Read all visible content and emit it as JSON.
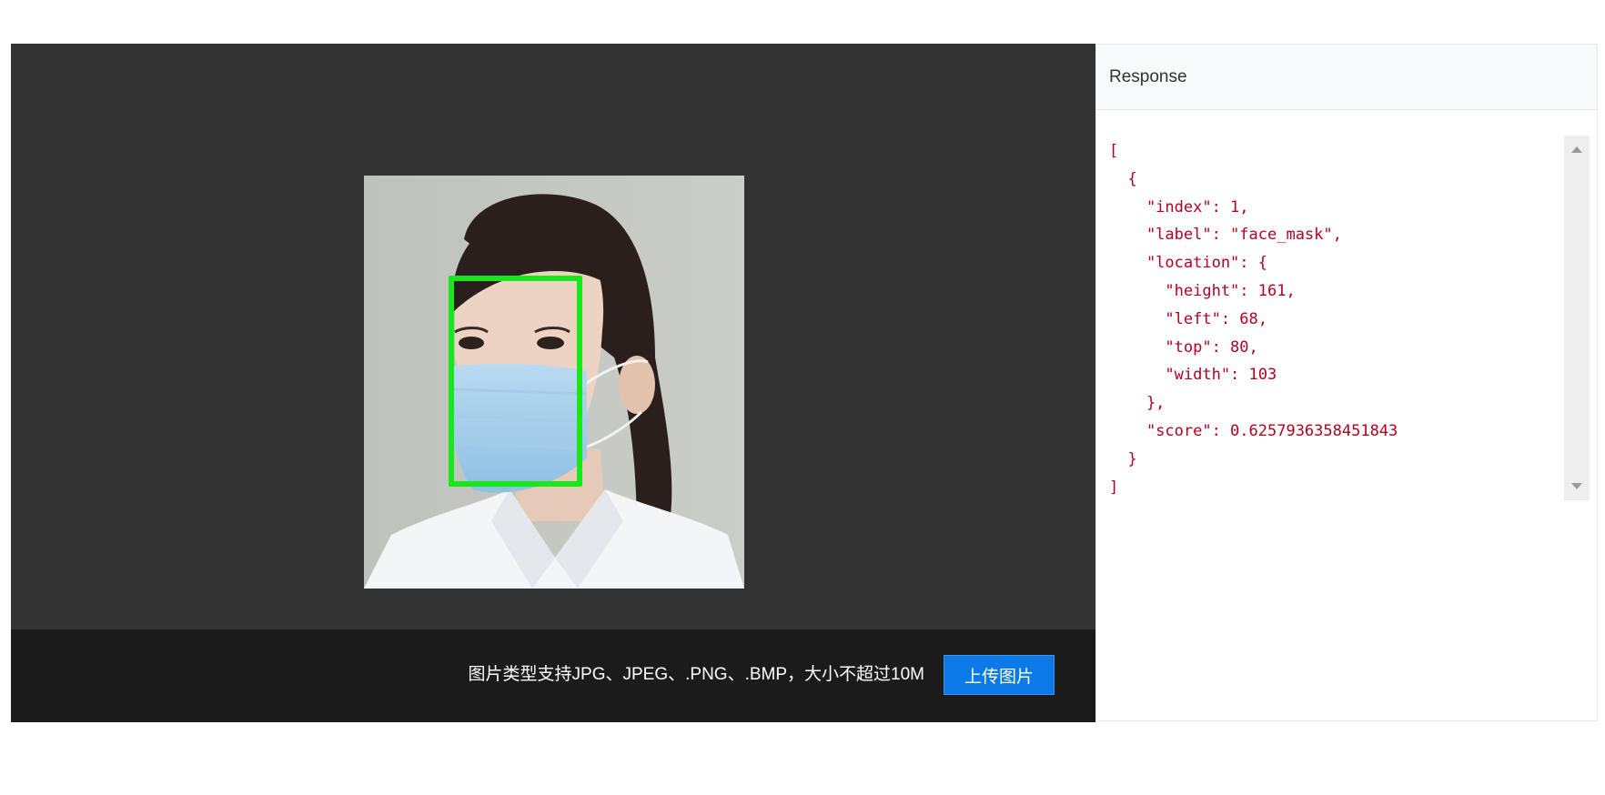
{
  "preview": {
    "image_subject": "woman-wearing-face-mask-photo",
    "detection_box_color": "#18e81a"
  },
  "footer": {
    "hint": "图片类型支持JPG、JPEG、.PNG、.BMP，大小不超过10M",
    "upload_label": "上传图片"
  },
  "panel": {
    "title": "Response",
    "response_json": "[\n  {\n    \"index\": 1,\n    \"label\": \"face_mask\",\n    \"location\": {\n      \"height\": 161,\n      \"left\": 68,\n      \"top\": 80,\n      \"width\": 103\n    },\n    \"score\": 0.6257936358451843\n  }\n]"
  },
  "colors": {
    "stage_bg": "#333333",
    "footer_bg": "#1b1b1b",
    "button": "#0b7ae8",
    "code_text": "#b00020"
  }
}
